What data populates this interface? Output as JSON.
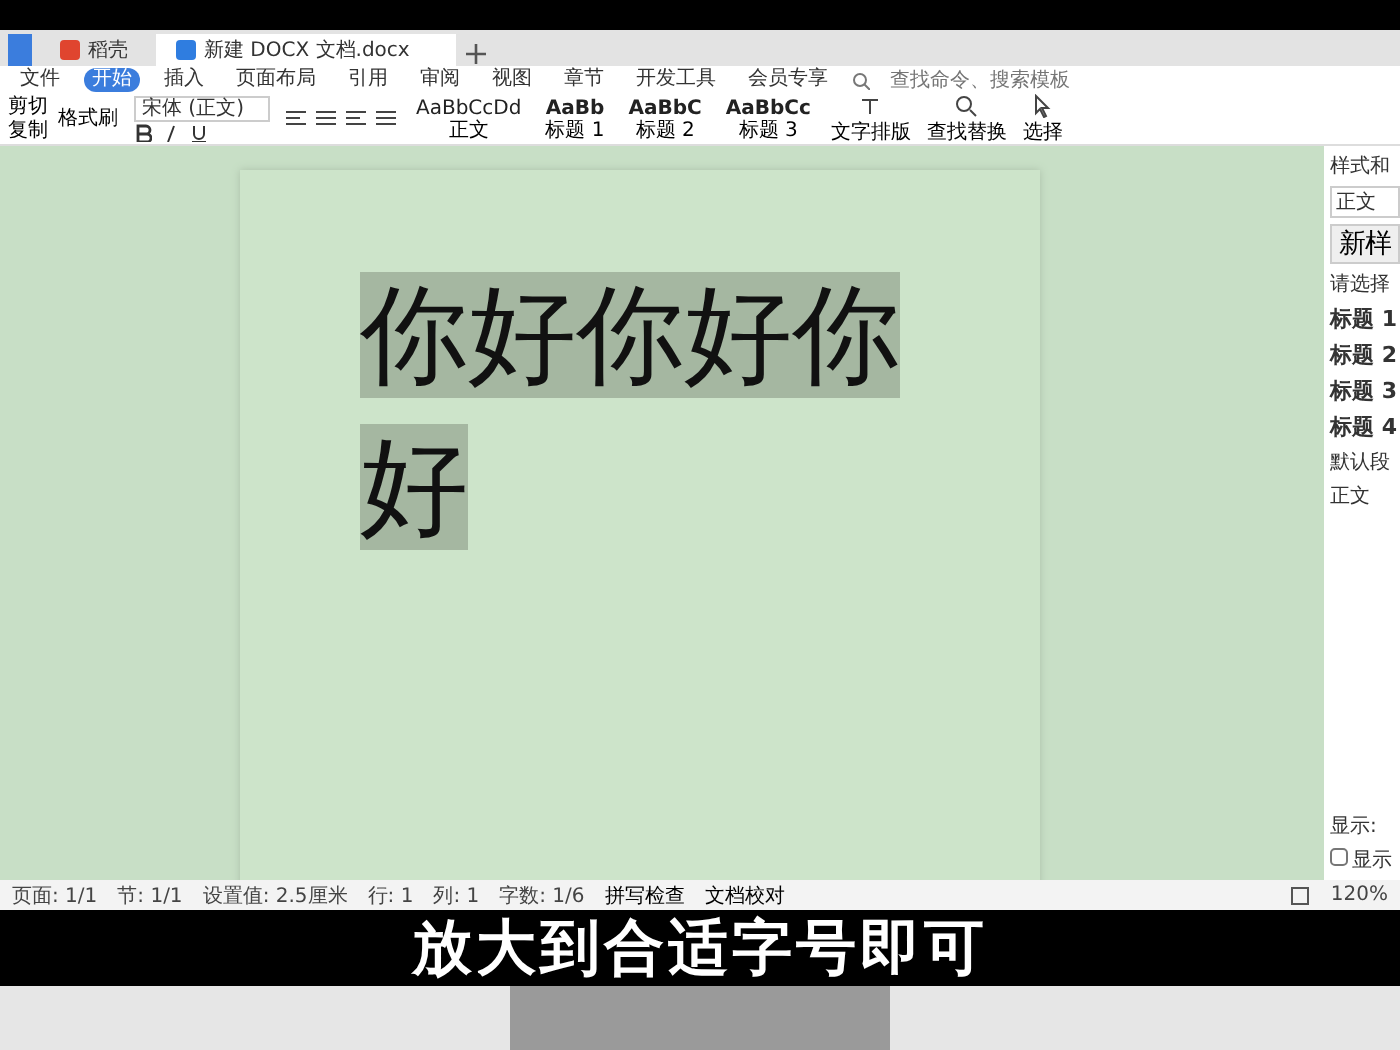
{
  "tabs": [
    {
      "label": "稻壳",
      "selected": false
    },
    {
      "label": "新建 DOCX 文档.docx",
      "selected": true
    }
  ],
  "menu": [
    {
      "label": "文件",
      "selected": false
    },
    {
      "label": "开始",
      "selected": true
    },
    {
      "label": "插入",
      "selected": false
    },
    {
      "label": "页面布局",
      "selected": false
    },
    {
      "label": "引用",
      "selected": false
    },
    {
      "label": "审阅",
      "selected": false
    },
    {
      "label": "视图",
      "selected": false
    },
    {
      "label": "章节",
      "selected": false
    },
    {
      "label": "开发工具",
      "selected": false
    },
    {
      "label": "会员专享",
      "selected": false
    }
  ],
  "search": {
    "placeholder": "查找命令、搜索模板"
  },
  "ribbon": {
    "clipboard": [
      "剪切",
      "复制",
      "格式刷"
    ],
    "font_name": "宋体 (正文)",
    "styles": [
      {
        "sample": "AaBbCcDd",
        "name": "正文"
      },
      {
        "sample": "AaBb",
        "name": "标题 1"
      },
      {
        "sample": "AaBbC",
        "name": "标题 2"
      },
      {
        "sample": "AaBbCc",
        "name": "标题 3"
      }
    ],
    "tools": [
      {
        "kind": "text",
        "label": "文字排版"
      },
      {
        "kind": "find",
        "label": "查找替换"
      },
      {
        "kind": "select",
        "label": "选择"
      }
    ]
  },
  "document": {
    "paragraphs": [
      {
        "text": "你好你好你好",
        "selected": true
      }
    ]
  },
  "side_pane": {
    "title": "样式和",
    "current": "正文",
    "new_style": "新样",
    "prompt": "请选择",
    "styles": [
      {
        "label": "标题 1"
      },
      {
        "label": "标题 2"
      },
      {
        "label": "标题 3"
      },
      {
        "label": "标题 4"
      }
    ],
    "default_font": "默认段",
    "body": "正文",
    "show": "显示:",
    "preview": {
      "label": "显示",
      "checked": false
    }
  },
  "status_bar": {
    "items": [
      "页面: 1/1",
      "节: 1/1",
      "设置值: 2.5厘米",
      "行: 1",
      "列: 1",
      "字数: 1/6"
    ],
    "spell": "拼写检查",
    "proof": "文档校对",
    "zoom": "120%"
  },
  "caption": "放大到合适字号即可"
}
